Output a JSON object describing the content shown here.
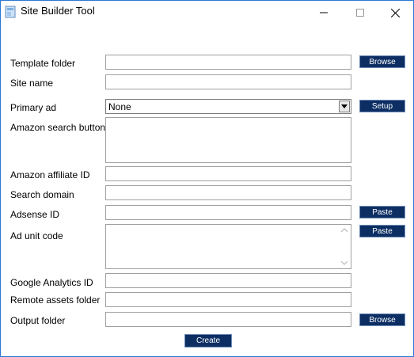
{
  "window": {
    "title": "Site Builder Tool"
  },
  "form": {
    "template_folder_label": "Template folder",
    "browse_label": "Browse",
    "site_name_label": "Site name",
    "primary_ad_label": "Primary ad",
    "primary_ad_value": "None",
    "setup_label": "Setup",
    "amazon_search_buttons_label": "Amazon search buttons",
    "amazon_affiliate_id_label": "Amazon affiliate ID",
    "search_domain_label": "Search domain",
    "adsense_id_label": "Adsense ID",
    "paste_label": "Paste",
    "ad_unit_code_label": "Ad unit code",
    "paste2_label": "Paste",
    "google_analytics_id_label": "Google Analytics ID",
    "remote_assets_folder_label": "Remote assets folder",
    "output_folder_label": "Output folder",
    "browse2_label": "Browse",
    "create_label": "Create"
  },
  "colors": {
    "button_bg": "#0c2e63",
    "button_text": "#ffffff",
    "window_border": "#2b79d6"
  }
}
